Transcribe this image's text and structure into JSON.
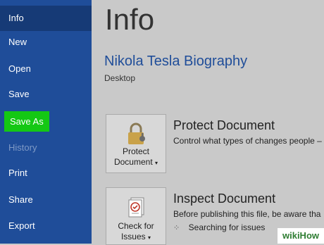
{
  "nav": [
    {
      "label": "Info"
    },
    {
      "label": "New"
    },
    {
      "label": "Open"
    },
    {
      "label": "Save"
    },
    {
      "label": "Save As"
    },
    {
      "label": "History"
    },
    {
      "label": "Print"
    },
    {
      "label": "Share"
    },
    {
      "label": "Export"
    }
  ],
  "main": {
    "title": "Info",
    "doc_name": "Nikola Tesla Biography",
    "location": "Desktop",
    "protect": {
      "button_line1": "Protect",
      "button_line2": "Document",
      "heading": "Protect Document",
      "desc": "Control what types of changes people –"
    },
    "inspect": {
      "button_line1": "Check for",
      "button_line2": "Issues",
      "heading": "Inspect Document",
      "desc": "Before publishing this file, be aware tha",
      "status": "Searching for issues"
    }
  },
  "watermark": "wikiHow",
  "colors": {
    "sidebar": "#1f4d99",
    "highlight": "#14c814"
  }
}
